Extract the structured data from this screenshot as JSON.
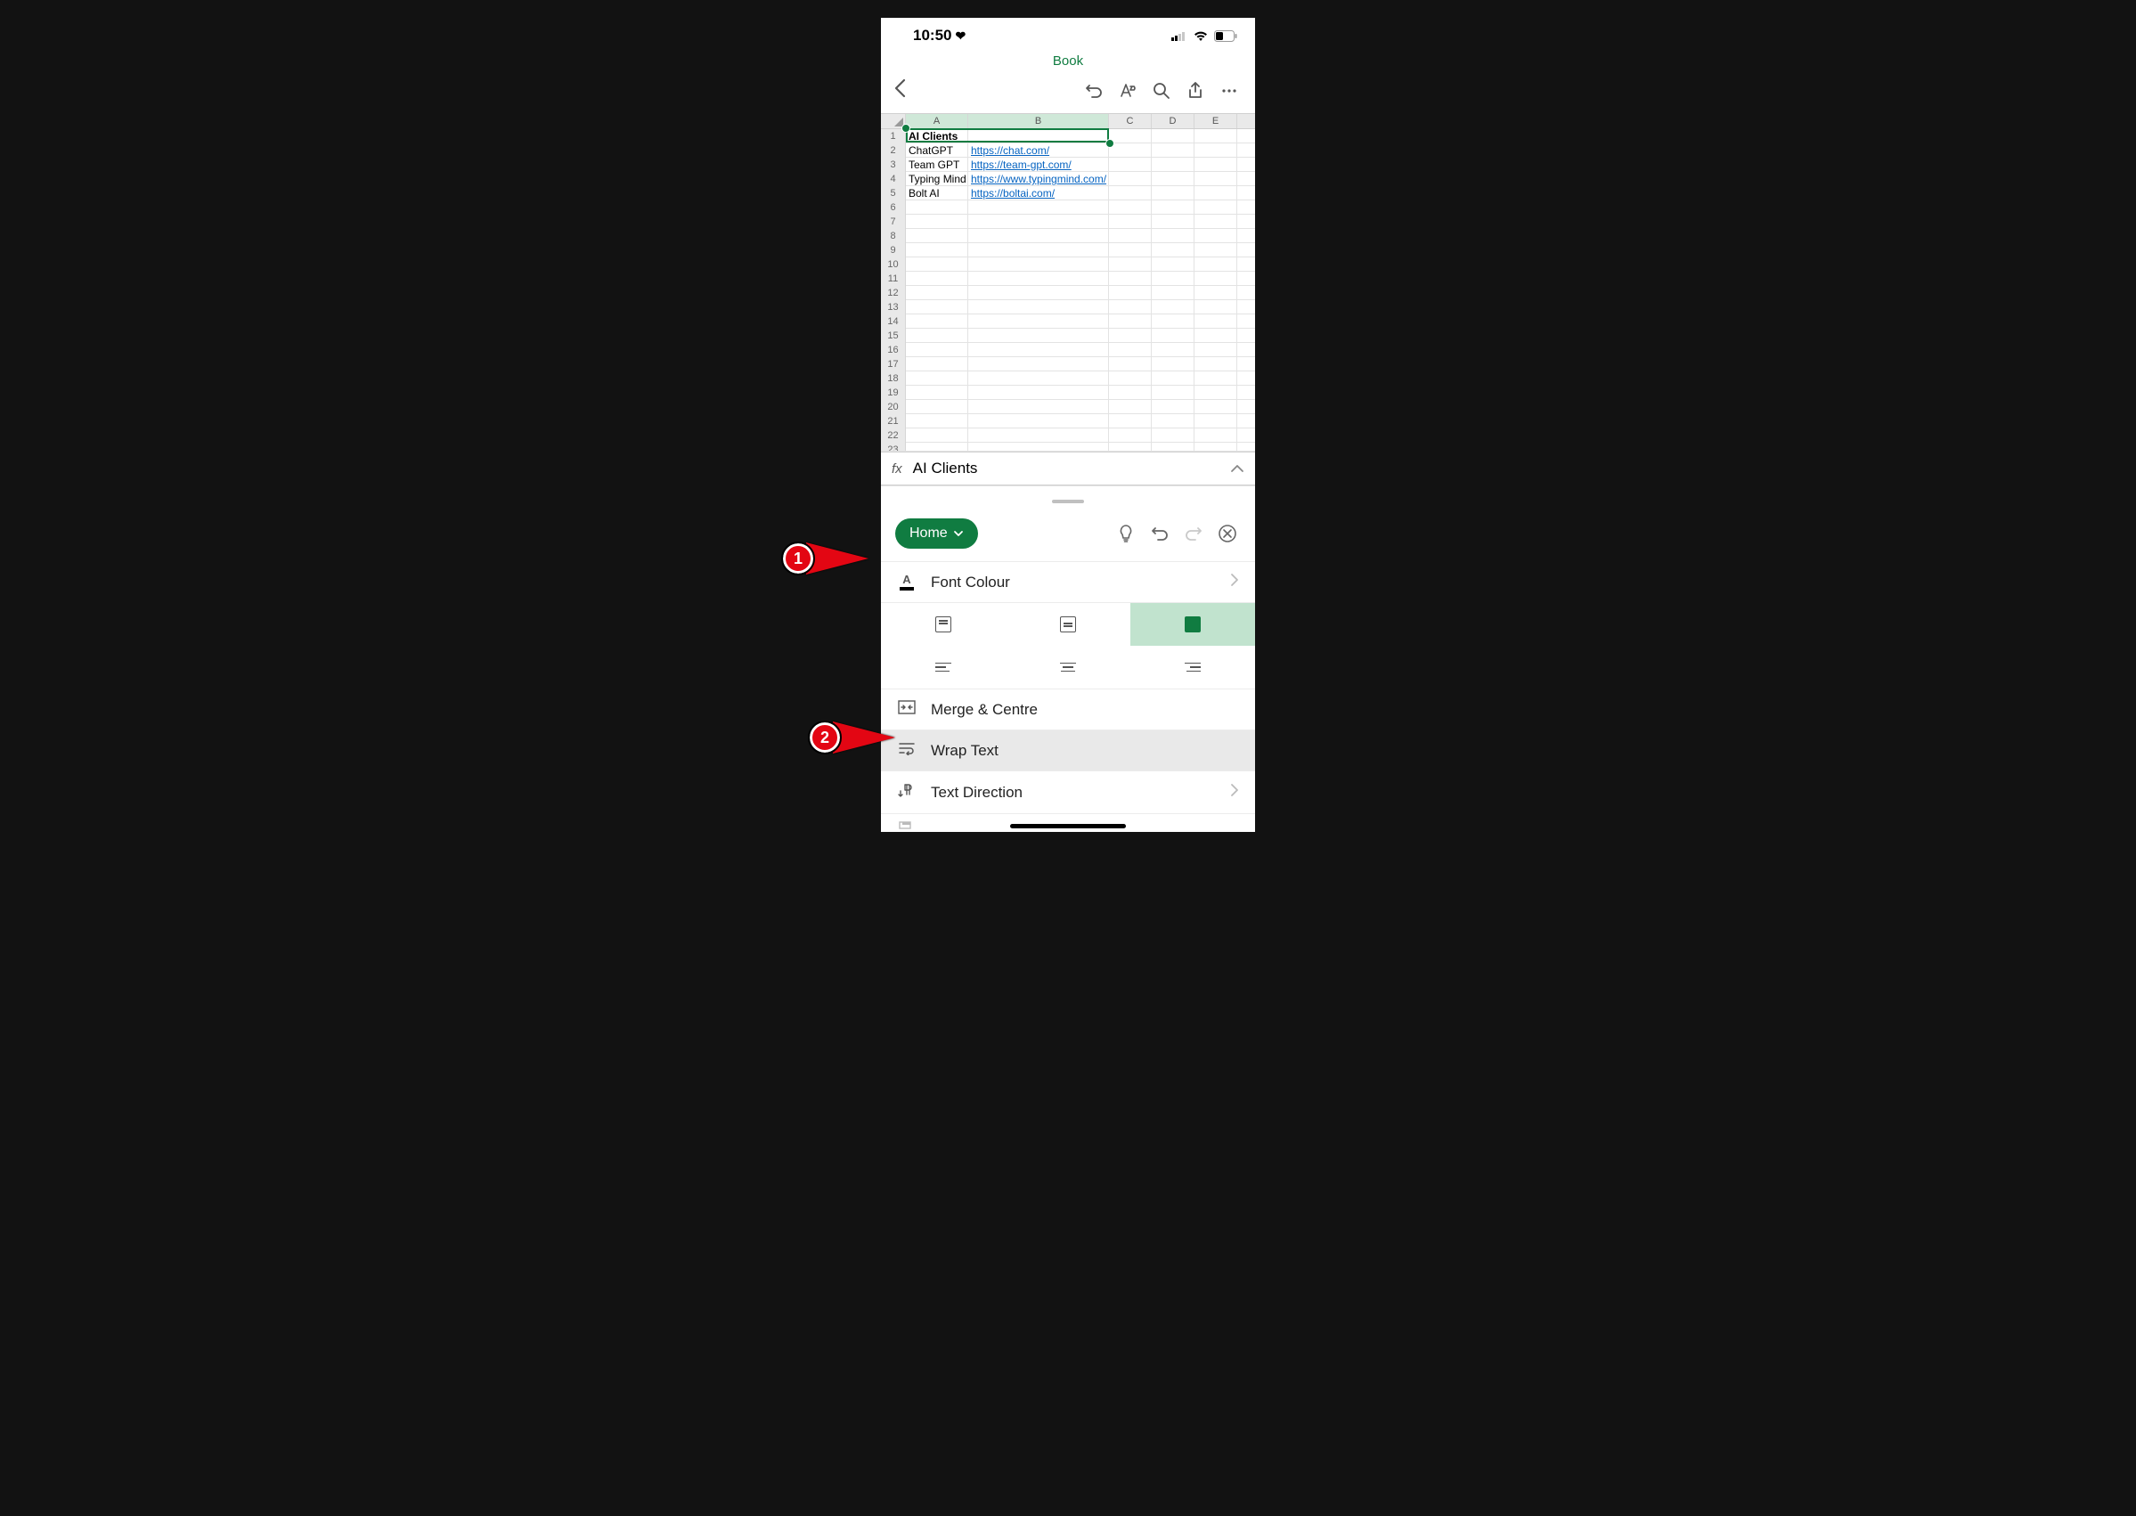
{
  "status": {
    "time": "10:50"
  },
  "doc": {
    "title": "Book"
  },
  "columns": [
    "A",
    "B",
    "C",
    "D",
    "E"
  ],
  "rows": {
    "r1": {
      "n": "1",
      "a": "AI Clients",
      "b": ""
    },
    "r2": {
      "n": "2",
      "a": "ChatGPT",
      "b": "https://chat.com/"
    },
    "r3": {
      "n": "3",
      "a": "Team GPT",
      "b": "https://team-gpt.com/"
    },
    "r4": {
      "n": "4",
      "a": "Typing Mind",
      "b": "https://www.typingmind.com/"
    },
    "r5": {
      "n": "5",
      "a": "Bolt AI",
      "b": "https://boltai.com/"
    },
    "r6": {
      "n": "6"
    },
    "r7": {
      "n": "7"
    },
    "r8": {
      "n": "8"
    },
    "r9": {
      "n": "9"
    },
    "r10": {
      "n": "10"
    },
    "r11": {
      "n": "11"
    },
    "r12": {
      "n": "12"
    },
    "r13": {
      "n": "13"
    },
    "r14": {
      "n": "14"
    },
    "r15": {
      "n": "15"
    },
    "r16": {
      "n": "16"
    },
    "r17": {
      "n": "17"
    },
    "r18": {
      "n": "18"
    },
    "r19": {
      "n": "19"
    },
    "r20": {
      "n": "20"
    },
    "r21": {
      "n": "21"
    },
    "r22": {
      "n": "22"
    },
    "r23": {
      "n": "23"
    }
  },
  "fx": {
    "label": "fx",
    "value": "AI Clients"
  },
  "panel": {
    "tab_label": "Home",
    "font_colour": "Font Colour",
    "merge_centre": "Merge & Centre",
    "wrap_text": "Wrap Text",
    "text_direction": "Text Direction",
    "format_painter_cut": "Format Painter"
  },
  "annotations": {
    "a1": "1",
    "a2": "2"
  }
}
